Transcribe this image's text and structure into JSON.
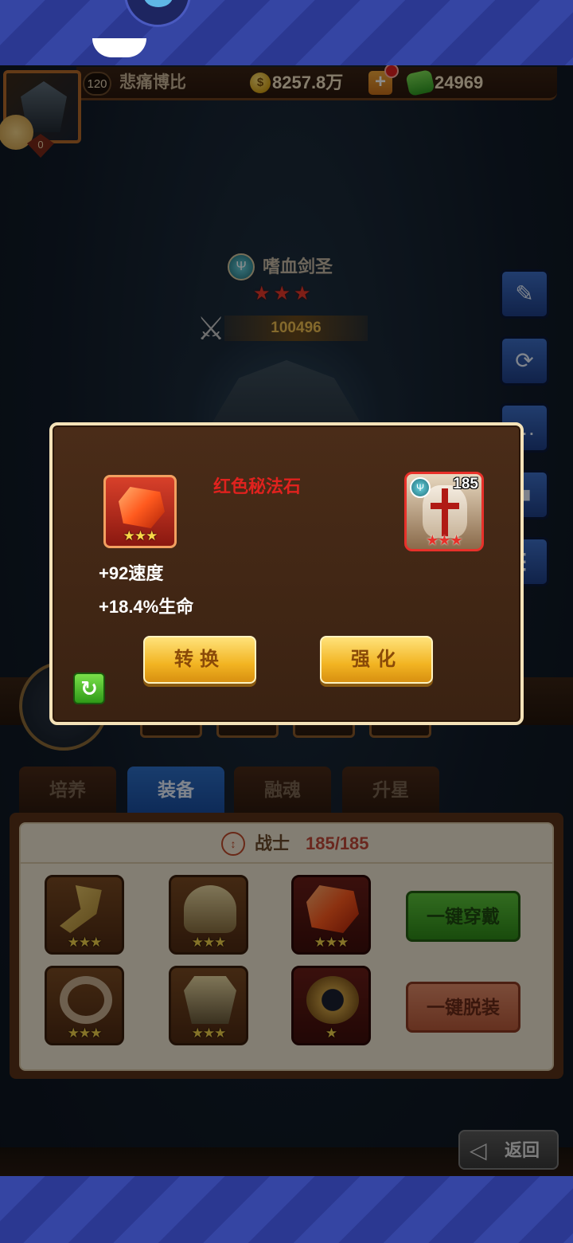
{
  "player": {
    "level": "120",
    "name": "悲痛博比",
    "gold": "8257.8万",
    "gems": "24969",
    "portrait_badge": "0"
  },
  "hero": {
    "name": "嗜血剑圣",
    "stars": 3,
    "power": "100496"
  },
  "tabs": [
    {
      "label": "培养",
      "active": false
    },
    {
      "label": "装备",
      "active": true
    },
    {
      "label": "融魂",
      "active": false
    },
    {
      "label": "升星",
      "active": false
    }
  ],
  "equipment_panel": {
    "class_name": "战士",
    "class_count": "185/185",
    "wear_all_label": "一键穿戴",
    "remove_all_label": "一键脱装"
  },
  "back_button": {
    "label": "返回"
  },
  "popup": {
    "item_name": "红色秘法石",
    "item_stars": "★★★",
    "stats": [
      "+92速度",
      "+18.4%生命"
    ],
    "hero_level": "185",
    "hero_stars": "★★★",
    "convert_label": "转换",
    "enhance_label": "强化"
  },
  "colors": {
    "item_name": "#e0221e",
    "active_tab": "#2d6fc7",
    "popup_border": "#f4e2b8"
  }
}
